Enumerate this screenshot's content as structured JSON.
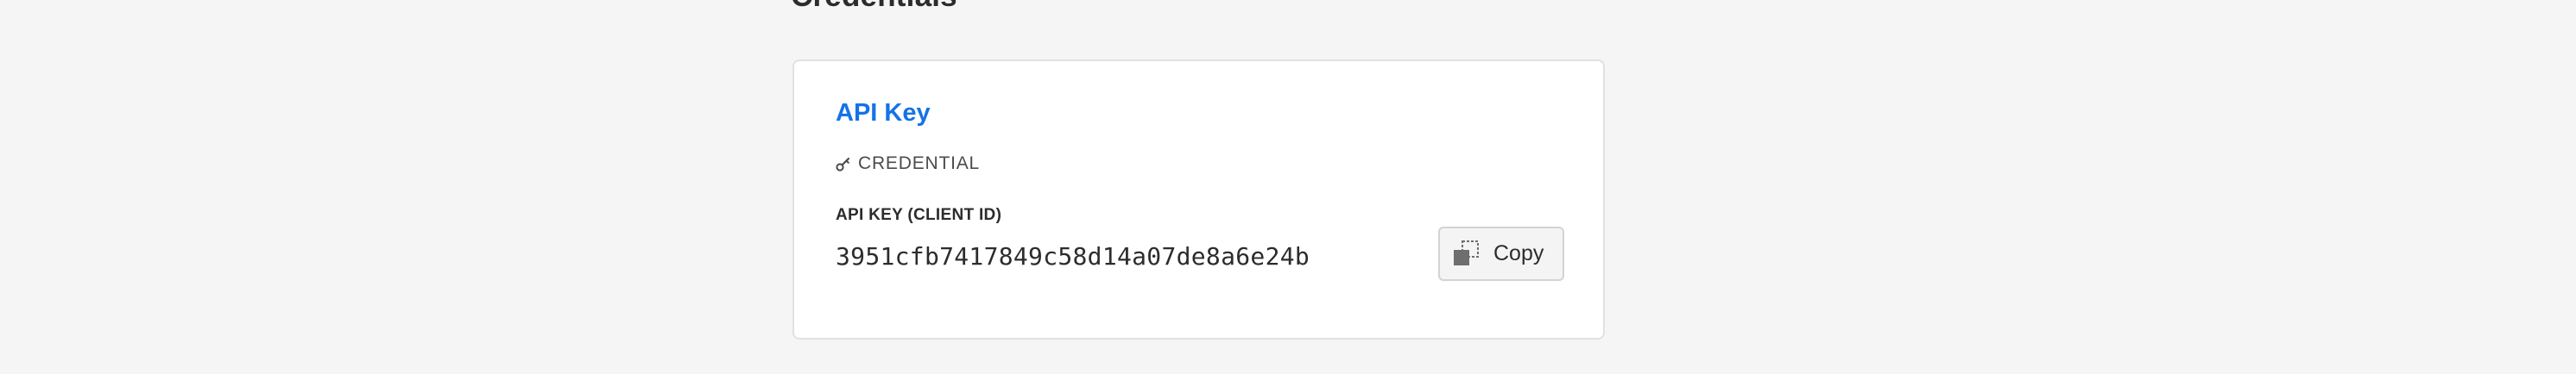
{
  "section": {
    "title": "Credentials"
  },
  "credential_card": {
    "title": "API Key",
    "type_icon": "key-icon",
    "type_label": "CREDENTIAL",
    "field_label": "API KEY (CLIENT ID)",
    "field_value": "3951cfb7417849c58d14a07de8a6e24b",
    "copy_icon": "copy-icon",
    "copy_label": "Copy"
  },
  "colors": {
    "page_background": "#f5f5f5",
    "card_background": "#ffffff",
    "accent": "#1473e6",
    "text": "#2c2c2c"
  }
}
